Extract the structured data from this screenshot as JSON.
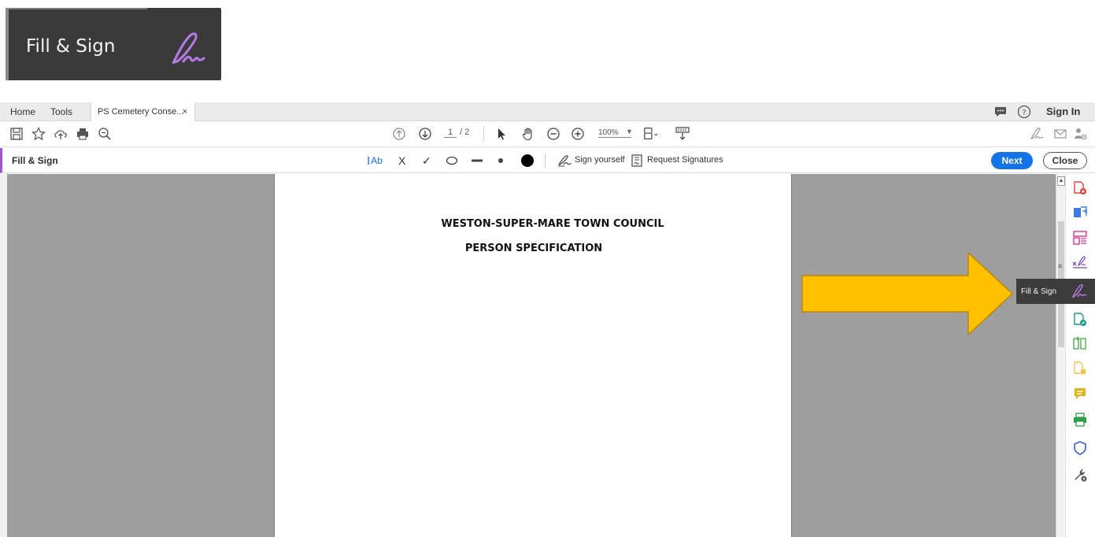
{
  "callout": {
    "label": "Fill & Sign",
    "icon": "fill-sign-pen-icon"
  },
  "tabs": {
    "home": "Home",
    "tools": "Tools",
    "document": "PS Cemetery Conse...",
    "close": "×"
  },
  "header": {
    "signin": "Sign In"
  },
  "toolbar": {
    "page_current": "1",
    "page_total": "/ 2",
    "zoom": "100%"
  },
  "fillsign": {
    "title": "Fill & Sign",
    "text_tool": "Ab",
    "cross": "X",
    "check": "✓",
    "sign_yourself": "Sign yourself",
    "request_signatures": "Request Signatures",
    "next": "Next",
    "close": "Close"
  },
  "document": {
    "title_line1": "WESTON-SUPER-MARE TOWN COUNCIL",
    "title_line2": "PERSON SPECIFICATION"
  },
  "tooltip": {
    "label": "Fill & Sign"
  },
  "colors": {
    "accent_purple": "#9b57d3",
    "next_blue": "#1473e6",
    "arrow_yellow": "#ffc000"
  }
}
